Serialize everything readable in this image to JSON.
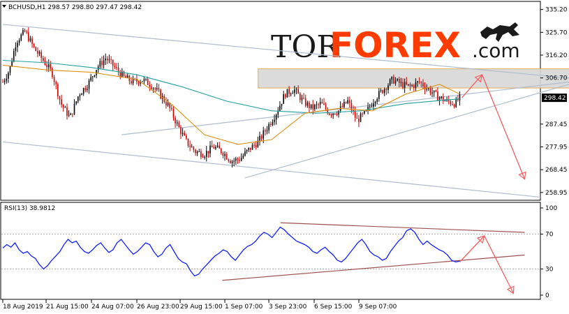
{
  "header": {
    "symbol_info": "BCHUSD,H1  298.57 298.80 297.47 298.42",
    "rsi_info": "RSI(13) 38.9812"
  },
  "logo": {
    "part1": "TOR",
    "part2": "FOREX",
    "part3": ".com",
    "color_dark": "#1a1a1a",
    "color_accent": "#ff3b00"
  },
  "chart_data": [
    {
      "type": "candlestick",
      "symbol": "BCHUSD",
      "timeframe": "H1",
      "ohlc_last": {
        "open": 298.57,
        "high": 298.8,
        "low": 297.47,
        "close": 298.42
      },
      "y_ticks": [
        "335.20",
        "325.70",
        "316.20",
        "306.70",
        "298.42",
        "287.45",
        "277.95",
        "268.45",
        "258.95"
      ],
      "ylim": [
        256,
        338
      ],
      "current_price_label": "298.42",
      "close_path": [
        [
          0,
          305
        ],
        [
          0.3,
          310
        ],
        [
          0.6,
          322
        ],
        [
          1,
          326
        ],
        [
          1.4,
          319
        ],
        [
          1.8,
          314
        ],
        [
          2.2,
          309
        ],
        [
          2.6,
          296
        ],
        [
          3.0,
          290
        ],
        [
          3.4,
          300
        ],
        [
          3.8,
          304
        ],
        [
          4.2,
          311
        ],
        [
          4.6,
          315
        ],
        [
          5,
          311
        ],
        [
          5.4,
          307
        ],
        [
          5.8,
          305
        ],
        [
          6.2,
          306
        ],
        [
          6.6,
          304
        ],
        [
          7,
          300
        ],
        [
          7.4,
          295
        ],
        [
          7.8,
          287
        ],
        [
          8.2,
          280
        ],
        [
          8.6,
          276
        ],
        [
          9,
          275
        ],
        [
          9.4,
          278
        ],
        [
          9.8,
          276
        ],
        [
          10.2,
          272
        ],
        [
          10.6,
          273
        ],
        [
          11,
          277
        ],
        [
          11.4,
          280
        ],
        [
          11.8,
          286
        ],
        [
          12.2,
          292
        ],
        [
          12.6,
          300
        ],
        [
          13,
          302
        ],
        [
          13.4,
          297
        ],
        [
          13.8,
          294
        ],
        [
          14.2,
          296
        ],
        [
          14.6,
          292
        ],
        [
          15,
          293
        ],
        [
          15.4,
          297
        ],
        [
          15.8,
          289
        ],
        [
          16.2,
          292
        ],
        [
          16.6,
          298
        ],
        [
          17,
          302
        ],
        [
          17.4,
          306
        ],
        [
          17.8,
          304
        ],
        [
          18.2,
          303
        ],
        [
          18.6,
          305
        ],
        [
          19,
          302
        ],
        [
          19.4,
          299
        ],
        [
          19.8,
          297
        ],
        [
          20.2,
          296
        ],
        [
          20.4,
          298.42
        ]
      ],
      "ma_slow": [
        [
          0,
          314
        ],
        [
          2,
          313
        ],
        [
          4,
          311
        ],
        [
          6,
          308
        ],
        [
          8,
          303
        ],
        [
          10,
          297
        ],
        [
          12,
          293
        ],
        [
          14,
          292
        ],
        [
          16,
          293
        ],
        [
          18,
          296
        ],
        [
          20.4,
          298
        ]
      ],
      "ma_fast": [
        [
          0,
          312
        ],
        [
          2,
          310
        ],
        [
          4,
          309
        ],
        [
          6,
          306
        ],
        [
          7.5,
          296
        ],
        [
          9,
          283
        ],
        [
          10.5,
          279
        ],
        [
          12,
          281
        ],
        [
          13.5,
          292
        ],
        [
          15,
          294
        ],
        [
          16.5,
          293
        ],
        [
          18,
          300
        ],
        [
          19.5,
          304
        ],
        [
          20.4,
          300
        ]
      ],
      "resistance_zone": {
        "from_x": 11.4,
        "to_x": 26.2,
        "y_low": 302.5,
        "y_high": 310.5
      },
      "arrows": [
        {
          "from": [
            20.5,
            298.5
          ],
          "to": [
            21.4,
            308.0
          ]
        },
        {
          "from": [
            21.4,
            308.0
          ],
          "to": [
            23.3,
            264.5
          ]
        }
      ]
    },
    {
      "type": "line",
      "name": "RSI(13)",
      "value": 38.9812,
      "y_ticks": [
        "100",
        "70",
        "30",
        "0"
      ],
      "ylim": [
        0,
        100
      ],
      "levels": [
        30,
        70
      ],
      "values": [
        54,
        58,
        55,
        60,
        52,
        48,
        50,
        45,
        42,
        35,
        30,
        34,
        40,
        45,
        50,
        58,
        64,
        60,
        62,
        55,
        50,
        48,
        52,
        57,
        60,
        54,
        49,
        52,
        60,
        64,
        58,
        52,
        47,
        50,
        55,
        60,
        58,
        50,
        44,
        47,
        54,
        58,
        50,
        42,
        38,
        36,
        28,
        22,
        24,
        30,
        35,
        40,
        45,
        48,
        52,
        50,
        44,
        40,
        46,
        52,
        56,
        58,
        62,
        68,
        72,
        70,
        66,
        72,
        78,
        75,
        70,
        66,
        62,
        60,
        58,
        55,
        50,
        48,
        52,
        55,
        50,
        46,
        40,
        38,
        42,
        48,
        54,
        60,
        64,
        58,
        50,
        46,
        44,
        40,
        42,
        50,
        56,
        62,
        66,
        74,
        76,
        72,
        64,
        58,
        62,
        58,
        55,
        52,
        50,
        46,
        40,
        38,
        39
      ]
    }
  ],
  "x_axis_labels": [
    "18 Aug 2019",
    "21 Aug 15:00",
    "24 Aug 07:00",
    "26 Aug 23:00",
    "29 Aug 15:00",
    "1 Sep 07:00",
    "3 Sep 23:00",
    "6 Sep 15:00",
    "9 Sep 07:00"
  ],
  "colors": {
    "bull": "#000000",
    "bear": "#cc0000",
    "ma_fast": "#e09010",
    "ma_slow": "#20a0a0",
    "channel": "#b0bcd0",
    "zone_fill": "#d8d8d8",
    "zone_border": "#e0b060",
    "arrow": "#f06060",
    "rsi_line": "#1020ff",
    "rsi_trend": "#a05050",
    "price_tag_bg": "#000000"
  }
}
